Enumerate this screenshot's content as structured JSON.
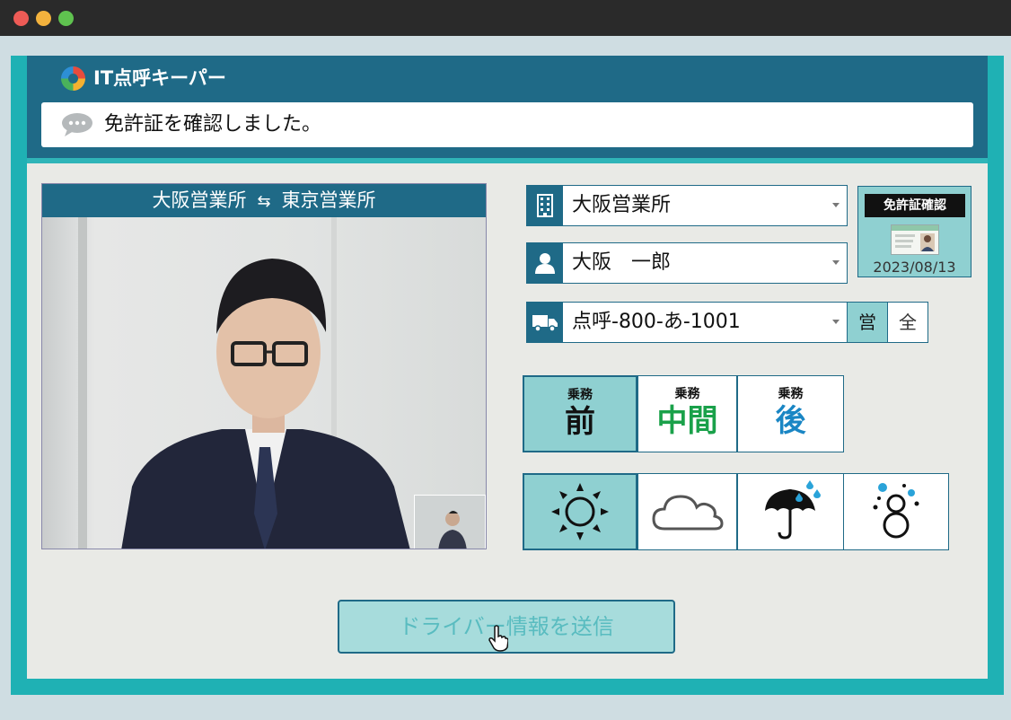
{
  "window": {
    "title": "IT点呼キーパー"
  },
  "message": {
    "text": "免許証を確認しました。"
  },
  "video": {
    "from_office": "大阪営業所",
    "to_office": "東京営業所"
  },
  "fields": {
    "office": "大阪営業所",
    "driver": "大阪　一郎",
    "vehicle": "点呼-800-あ-1001"
  },
  "license": {
    "label": "免許証確認",
    "date": "2023/08/13"
  },
  "vehicle_toggle": {
    "sales": "営",
    "all": "全",
    "selected": "sales"
  },
  "duty": {
    "prefix": "乗務",
    "options": [
      {
        "label": "前",
        "color": "#111111"
      },
      {
        "label": "中間",
        "color": "#1aa14a"
      },
      {
        "label": "後",
        "color": "#1a86c4"
      }
    ],
    "selected": 0
  },
  "weather": {
    "options": [
      "sun-icon",
      "cloud-icon",
      "rain-icon",
      "snow-icon"
    ],
    "selected": 0
  },
  "send_button": {
    "label": "ドライバー情報を送信"
  },
  "colors": {
    "primary": "#1f6a87",
    "accent": "#2fb5b8",
    "selected": "#8fd0d1"
  }
}
